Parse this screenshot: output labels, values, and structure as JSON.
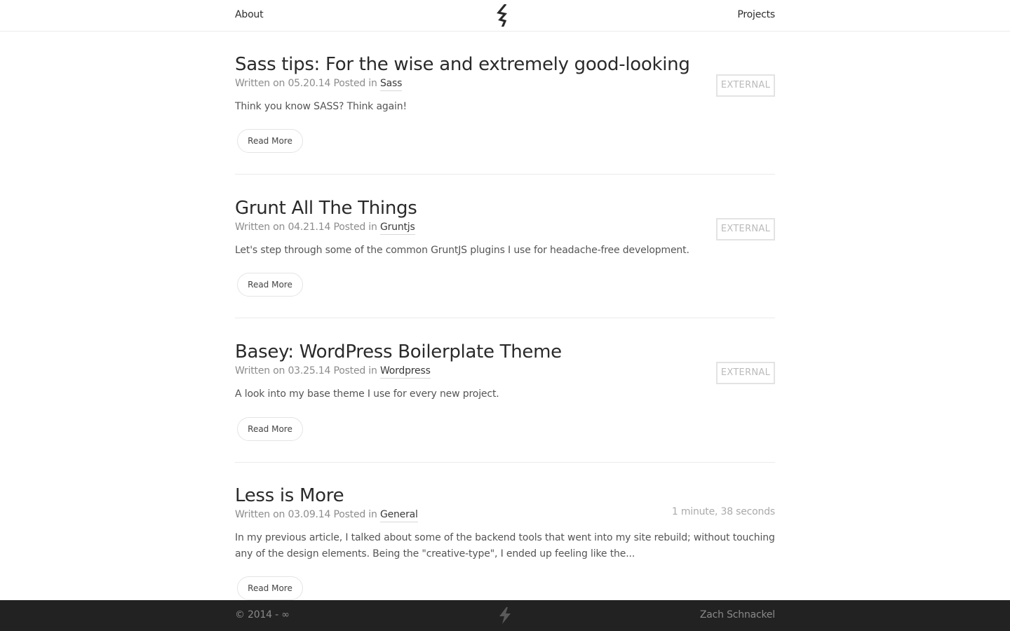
{
  "nav": {
    "about_label": "About",
    "projects_label": "Projects",
    "logo_icon": "lightning-bolt-logo-icon"
  },
  "posts": [
    {
      "title": "Sass tips: For the wise and extremely good-looking",
      "meta_prefix": "Written on 05.20.14 Posted in",
      "category": "Sass",
      "excerpt": "Think you know SASS? Think again!",
      "badge": "EXTERNAL",
      "read_more": "Read More"
    },
    {
      "title": "Grunt All The Things",
      "meta_prefix": "Written on 04.21.14 Posted in",
      "category": "Gruntjs",
      "excerpt": "Let's step through some of the common GruntJS plugins I use for headache-free development.",
      "badge": "EXTERNAL",
      "read_more": "Read More"
    },
    {
      "title": "Basey: WordPress Boilerplate Theme",
      "meta_prefix": "Written on 03.25.14 Posted in",
      "category": "Wordpress",
      "excerpt": "A look into my base theme I use for every new project.",
      "badge": "EXTERNAL",
      "read_more": "Read More"
    },
    {
      "title": "Less is More",
      "meta_prefix": "Written on 03.09.14 Posted in",
      "category": "General",
      "excerpt": "In my previous article, I talked about some of the backend tools that went into my site rebuild; without touching any of the design elements. Being the \"creative-type\", I ended up feeling like the...",
      "read_time": "1 minute, 38 seconds",
      "read_more": "Read More"
    }
  ],
  "footer": {
    "copyright": "© 2014 - ∞",
    "author": "Zach Schnackel",
    "logo_icon": "lightning-bolt-icon"
  },
  "colors": {
    "footer_bg": "#222222",
    "text": "#333333",
    "muted": "#8c8c8c",
    "badge_border": "#e3e3e3"
  }
}
